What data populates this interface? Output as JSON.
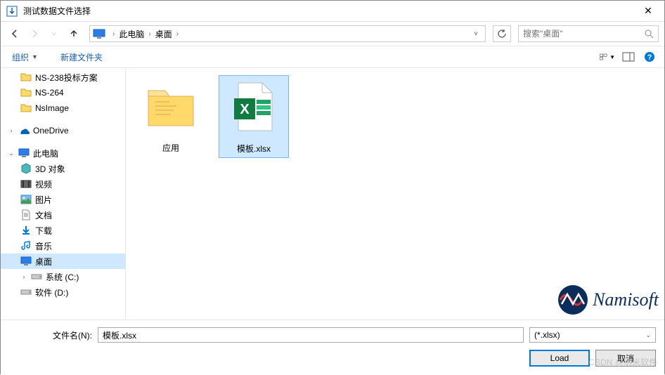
{
  "title": "测试数据文件选择",
  "breadcrumb": {
    "root": "此电脑",
    "loc": "桌面"
  },
  "search": {
    "placeholder": "搜索\"桌面\""
  },
  "toolbar": {
    "organize": "组织",
    "newfolder": "新建文件夹"
  },
  "sidebar": {
    "top": [
      {
        "label": "NS-238投标方案"
      },
      {
        "label": "NS-264"
      },
      {
        "label": "NsImage"
      }
    ],
    "onedrive": "OneDrive",
    "thispc": "此电脑",
    "pcitems": [
      {
        "label": "3D 对象"
      },
      {
        "label": "视频"
      },
      {
        "label": "图片"
      },
      {
        "label": "文档"
      },
      {
        "label": "下载"
      },
      {
        "label": "音乐"
      },
      {
        "label": "桌面"
      },
      {
        "label": "系统 (C:)"
      },
      {
        "label": "软件 (D:)"
      }
    ]
  },
  "files": {
    "folder": "应用",
    "selected": "模板.xlsx"
  },
  "brand": "Namisoft",
  "footer": {
    "label": "文件名(N):",
    "value": "模板.xlsx",
    "filter": "(*.xlsx)",
    "load": "Load",
    "cancel": "取消"
  },
  "csdn": "CSDN @纳米软件"
}
